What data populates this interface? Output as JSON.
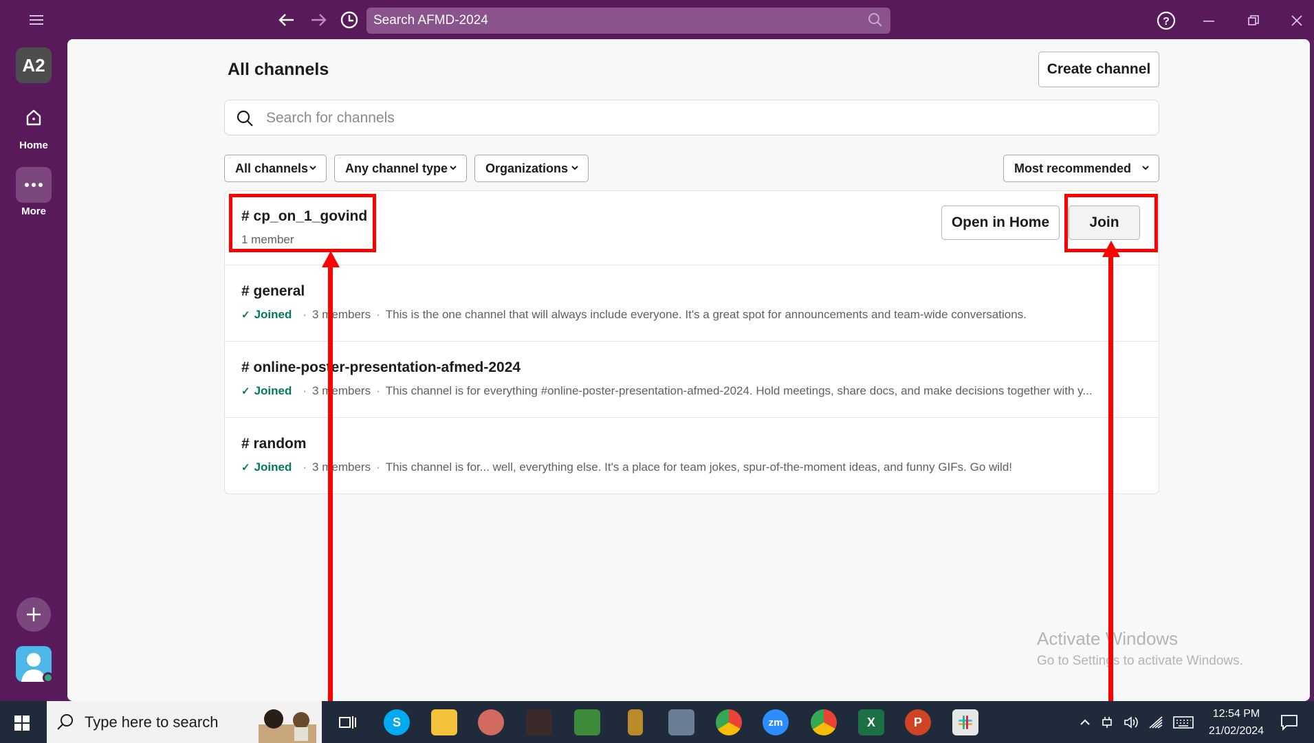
{
  "titlebar": {
    "search_text": "Search AFMD-2024",
    "icons": [
      "menu-icon",
      "back-arrow-icon",
      "forward-arrow-icon",
      "history-icon",
      "help-icon",
      "minimize-icon",
      "restore-icon",
      "close-icon"
    ]
  },
  "rail": {
    "workspace_initials": "A2",
    "home_label": "Home",
    "more_label": "More"
  },
  "page": {
    "title": "All channels",
    "create_button": "Create channel",
    "search_placeholder": "Search for channels"
  },
  "filters": {
    "scope": "All channels",
    "type": "Any channel type",
    "org": "Organizations",
    "sort": "Most recommended"
  },
  "channels": [
    {
      "name": "# cp_on_1_govind",
      "members": "1 member",
      "open_button": "Open in Home",
      "join_button": "Join"
    },
    {
      "name": "# general",
      "joined": "Joined",
      "members": "3 members",
      "description": "This is the one channel that will always include everyone. It's a great spot for announcements and team-wide conversations."
    },
    {
      "name": "# online-poster-presentation-afmed-2024",
      "joined": "Joined",
      "members": "3 members",
      "description": "This channel is for everything #online-poster-presentation-afmed-2024. Hold meetings, share docs, and make decisions together with y..."
    },
    {
      "name": "# random",
      "joined": "Joined",
      "members": "3 members",
      "description": "This channel is for... well, everything else. It's a place for team jokes, spur-of-the-moment ideas, and funny GIFs. Go wild!"
    }
  ],
  "watermark": {
    "line1": "Activate Windows",
    "line2": "Go to Settings to activate Windows."
  },
  "taskbar": {
    "search_placeholder": "Type here to search",
    "time": "12:54 PM",
    "date": "21/02/2024"
  },
  "colors": {
    "aubergine": "#591a5c",
    "joined_green": "#007a5a",
    "annotation_red": "#ff0000"
  }
}
